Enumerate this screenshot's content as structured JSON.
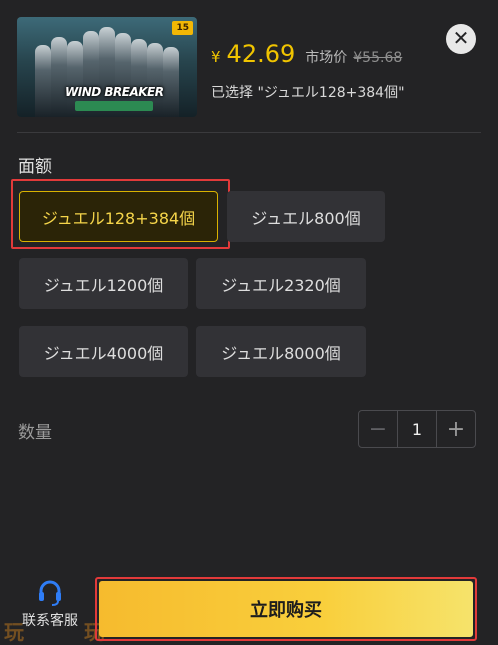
{
  "product": {
    "badge": "15",
    "logo_text": "WIND BREAKER",
    "price_symbol": "¥",
    "price": "42.69",
    "market_label": "市场价",
    "market_price": "¥55.68",
    "selected_text": "已选择 \"ジュエル128+384個\""
  },
  "close": {
    "glyph": "✕"
  },
  "denomination": {
    "title": "面额",
    "options": [
      {
        "label": "ジュエル128+384個",
        "selected": true
      },
      {
        "label": "ジュエル800個",
        "selected": false
      },
      {
        "label": "ジュエル1200個",
        "selected": false
      },
      {
        "label": "ジュエル2320個",
        "selected": false
      },
      {
        "label": "ジュエル4000個",
        "selected": false
      },
      {
        "label": "ジュエル8000個",
        "selected": false
      }
    ]
  },
  "quantity": {
    "label": "数量",
    "minus": "−",
    "value": "1",
    "plus": "+"
  },
  "footer": {
    "customer_service": "联系客服",
    "buy": "立即购买",
    "watermark_left": "玩",
    "watermark_right": "玩"
  },
  "colors": {
    "accent": "#f0c400",
    "highlight_frame": "#e23a3a",
    "background": "#232325"
  },
  "icons": {
    "close": "close-icon",
    "service": "headset-icon",
    "minus": "minus-icon",
    "plus": "plus-icon"
  }
}
